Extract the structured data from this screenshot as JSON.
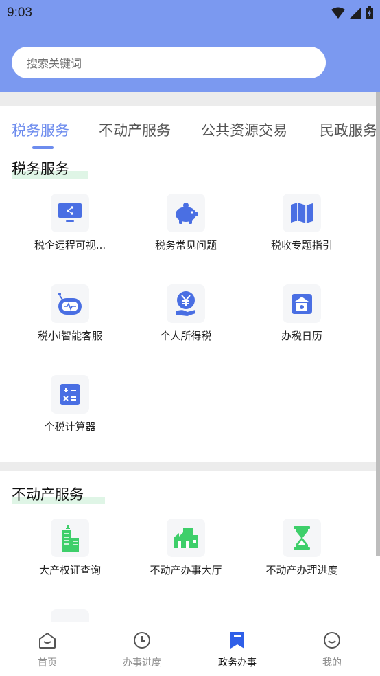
{
  "status_bar": {
    "time": "9:03"
  },
  "search": {
    "placeholder": "搜索关键词"
  },
  "tabs": [
    {
      "label": "税务服务",
      "active": true
    },
    {
      "label": "不动产服务"
    },
    {
      "label": "公共资源交易"
    },
    {
      "label": "民政服务"
    }
  ],
  "sections": [
    {
      "title": "税务服务",
      "items": [
        {
          "label": "税企远程可视...",
          "icon": "screen-share-icon"
        },
        {
          "label": "税务常见问题",
          "icon": "piggy-bank-icon"
        },
        {
          "label": "税收专题指引",
          "icon": "map-book-icon"
        },
        {
          "label": "税小i智能客服",
          "icon": "robot-icon"
        },
        {
          "label": "个人所得税",
          "icon": "yuan-hand-icon"
        },
        {
          "label": "办税日历",
          "icon": "building-calendar-icon"
        },
        {
          "label": "个税计算器",
          "icon": "calculator-icon"
        }
      ]
    },
    {
      "title": "不动产服务",
      "items": [
        {
          "label": "大产权证查询",
          "icon": "tower-building-icon"
        },
        {
          "label": "不动产办事大厅",
          "icon": "hall-buildings-icon"
        },
        {
          "label": "不动产办理进度",
          "icon": "hourglass-icon"
        }
      ]
    }
  ],
  "bottom_nav": [
    {
      "label": "首页",
      "icon": "home-icon"
    },
    {
      "label": "办事进度",
      "icon": "clock-icon"
    },
    {
      "label": "政务办事",
      "icon": "bookmark-icon",
      "active": true
    },
    {
      "label": "我的",
      "icon": "smile-icon"
    }
  ],
  "colors": {
    "header": "#7b99f0",
    "accent": "#6d8cee",
    "tax_icon": "#4a6fe3",
    "estate_icon": "#3ecf6a"
  }
}
